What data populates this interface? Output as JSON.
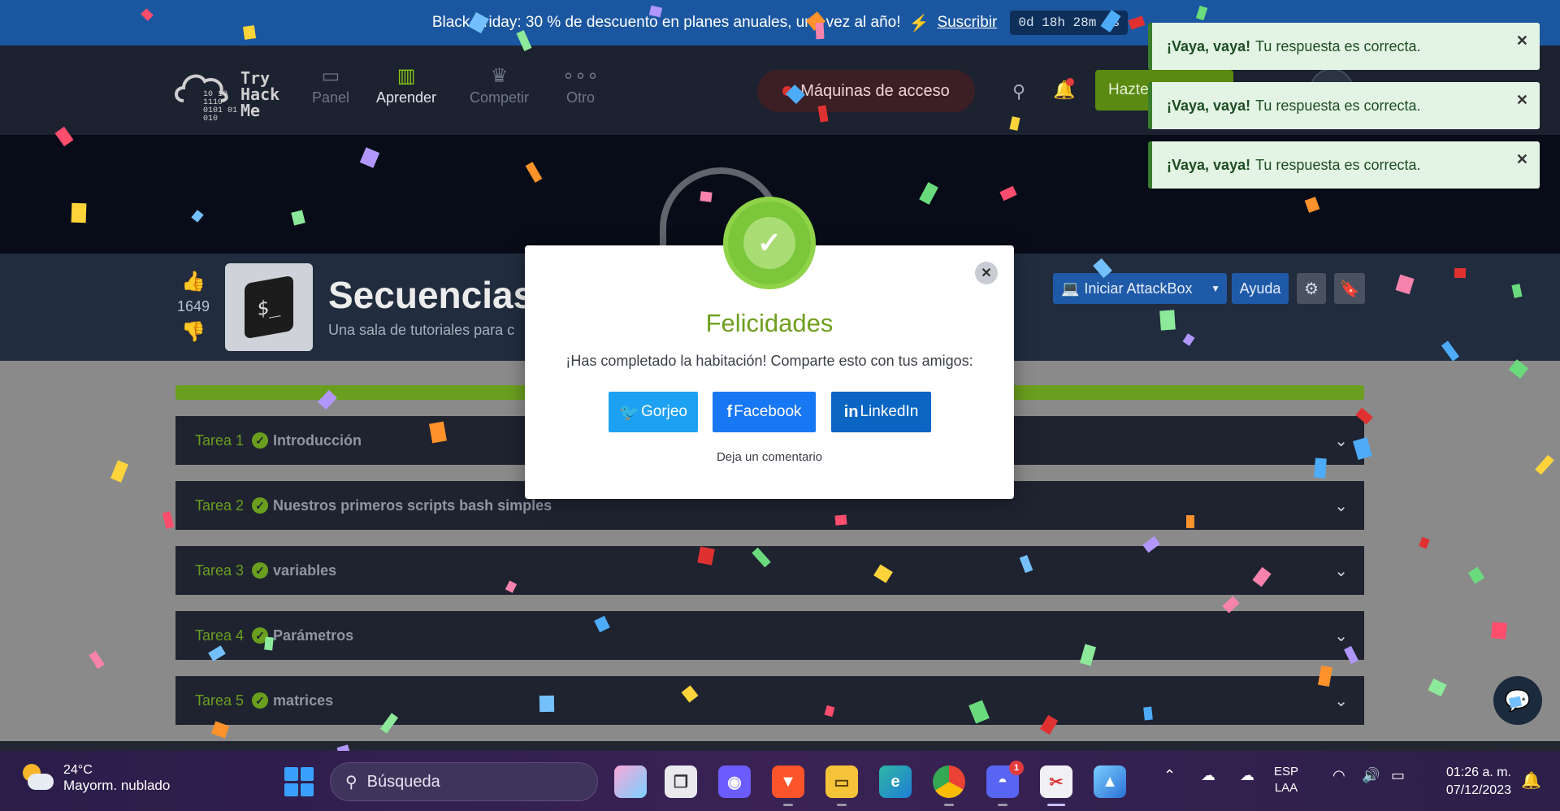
{
  "banner": {
    "text": "Black Friday: 30 % de descuento en planes anuales, una vez al año!",
    "subscribe": "Suscribir",
    "timer": "0d 18h 28m 0s"
  },
  "nav": {
    "logo": {
      "word1": "Try",
      "word2": "Hack",
      "word3": "Me",
      "bin": "10 10\n1110\n0101 01\n010"
    },
    "items": [
      {
        "label": "Panel",
        "icon": "panel-icon"
      },
      {
        "label": "Aprender",
        "icon": "book-icon"
      },
      {
        "label": "Competir",
        "icon": "trophy-icon"
      },
      {
        "label": "Otro",
        "icon": "dots-icon"
      }
    ],
    "machines": "Máquinas de acceso",
    "upgrade": "Hazte"
  },
  "room": {
    "likes": "1649",
    "title": "Secuencias",
    "subtitle": "Una sala de tutoriales para c",
    "attackbox": "Iniciar AttackBox",
    "help": "Ayuda"
  },
  "tasks": [
    {
      "num": "Tarea 1",
      "name": "Introducción"
    },
    {
      "num": "Tarea 2",
      "name": "Nuestros primeros scripts bash simples"
    },
    {
      "num": "Tarea 3",
      "name": "variables"
    },
    {
      "num": "Tarea 4",
      "name": "Parámetros"
    },
    {
      "num": "Tarea 5",
      "name": "matrices"
    }
  ],
  "modal": {
    "title": "Felicidades",
    "text": "¡Has completado la habitación! Comparte esto con tus amigos:",
    "twitter": "Gorjeo",
    "facebook": "Facebook",
    "linkedin": "LinkedIn",
    "comment": "Deja un comentario"
  },
  "toasts": [
    {
      "bold": "¡Vaya, vaya!",
      "text": "Tu respuesta es correcta."
    },
    {
      "bold": "¡Vaya, vaya!",
      "text": "Tu respuesta es correcta."
    },
    {
      "bold": "¡Vaya, vaya!",
      "text": "Tu respuesta es correcta."
    }
  ],
  "taskbar": {
    "temp": "24°C",
    "weather": "Mayorm. nublado",
    "search": "Búsqueda",
    "discord_badge": "1",
    "lang1": "ESP",
    "lang2": "LAA",
    "time": "01:26 a. m.",
    "date": "07/12/2023"
  },
  "colors": {
    "accent_green": "#88cc14",
    "banner_blue": "#1b57a0",
    "toast_bg": "#e3f4e4"
  }
}
